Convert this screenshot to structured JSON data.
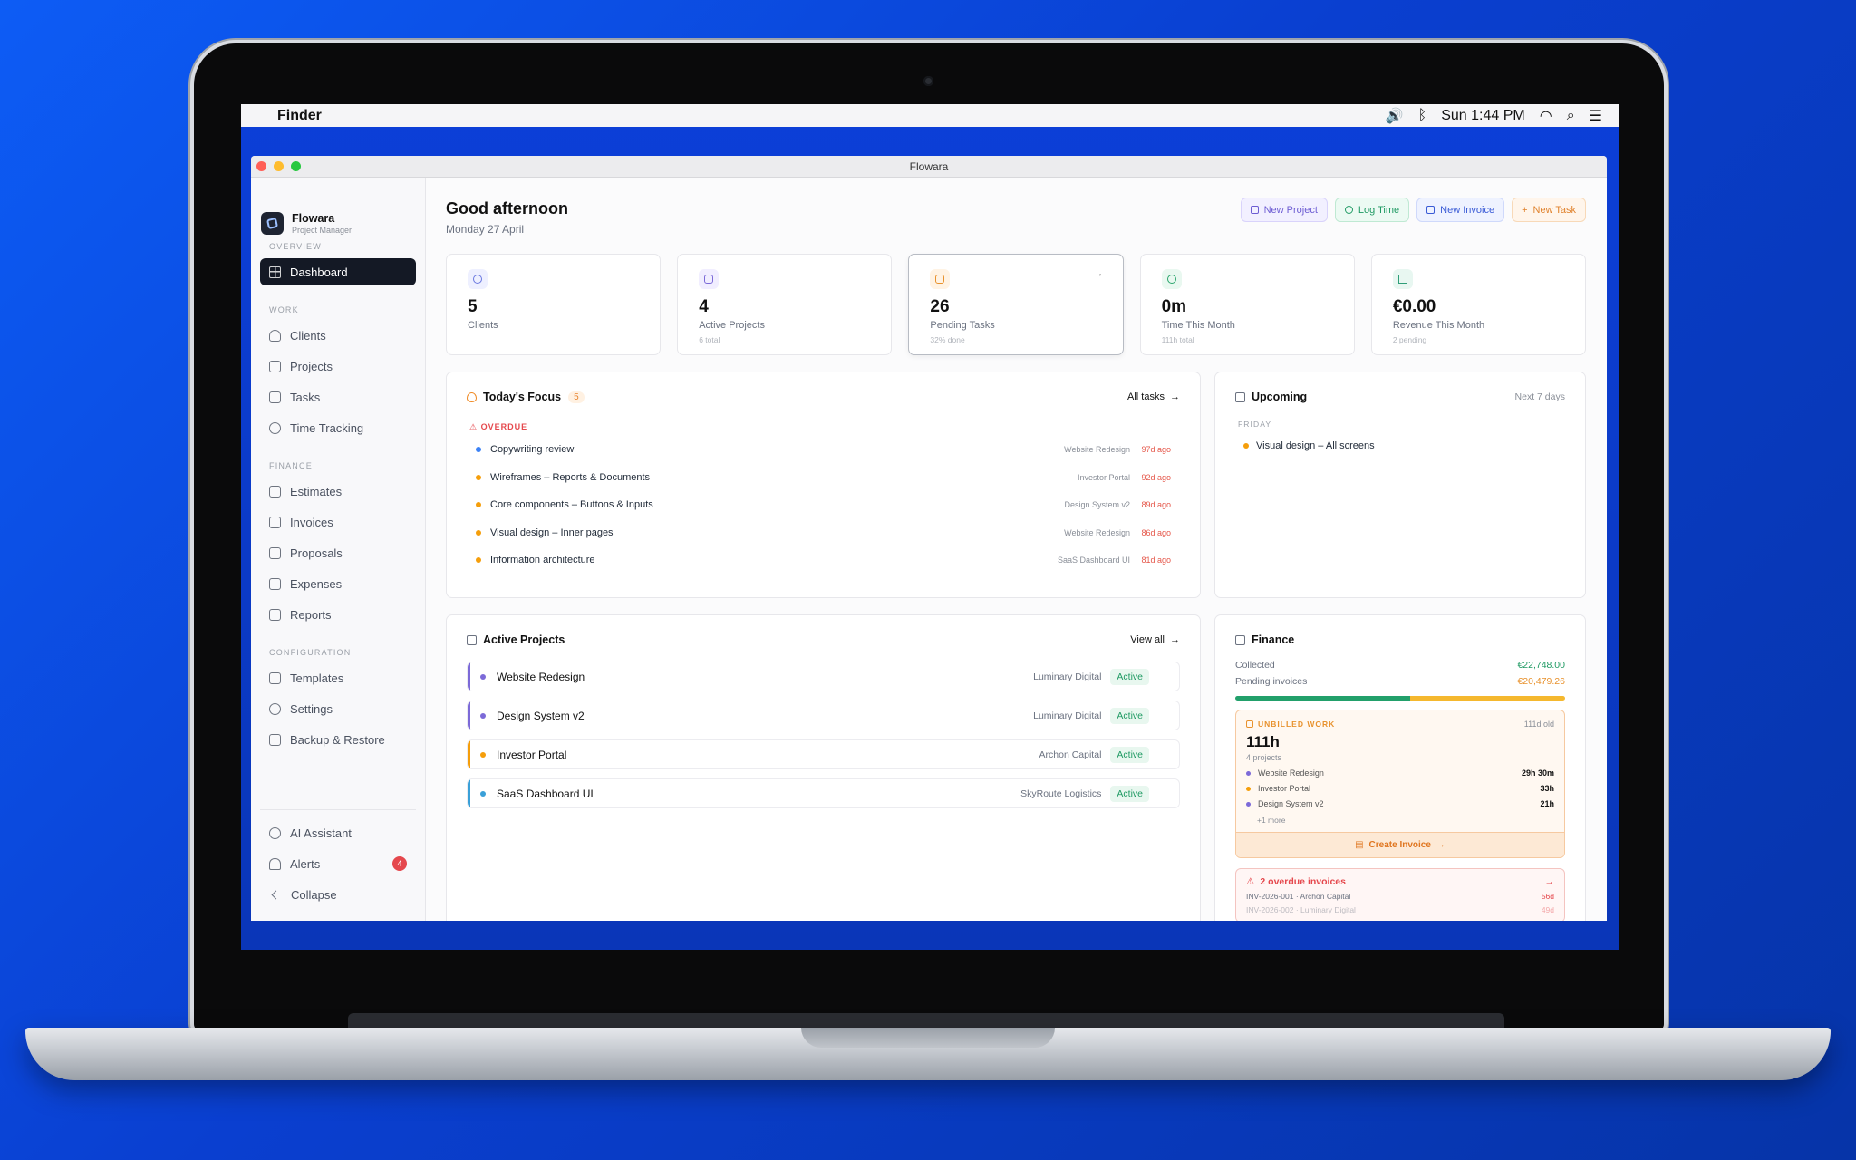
{
  "menubar": {
    "app_name": "Finder",
    "clock": "Sun 1:44 PM"
  },
  "window": {
    "title": "Flowara"
  },
  "brand": {
    "name": "Flowara",
    "subtitle": "Project Manager"
  },
  "sidebar": {
    "sections": {
      "overview": "OVERVIEW",
      "work": "WORK",
      "finance": "FINANCE",
      "configuration": "CONFIGURATION"
    },
    "items": {
      "dashboard": "Dashboard",
      "clients": "Clients",
      "projects": "Projects",
      "tasks": "Tasks",
      "time_tracking": "Time Tracking",
      "estimates": "Estimates",
      "invoices": "Invoices",
      "proposals": "Proposals",
      "expenses": "Expenses",
      "reports": "Reports",
      "templates": "Templates",
      "settings": "Settings",
      "backup": "Backup & Restore",
      "ai_assistant": "AI Assistant",
      "alerts": "Alerts",
      "alerts_count": "4",
      "collapse": "Collapse"
    }
  },
  "header": {
    "greeting": "Good afternoon",
    "date": "Monday 27 April",
    "buttons": {
      "new_project": "New Project",
      "log_time": "Log Time",
      "new_invoice": "New Invoice",
      "new_task": "New Task"
    }
  },
  "stats": [
    {
      "value": "5",
      "label": "Clients",
      "sub": ""
    },
    {
      "value": "4",
      "label": "Active Projects",
      "sub": "6 total"
    },
    {
      "value": "26",
      "label": "Pending Tasks",
      "sub": "32% done"
    },
    {
      "value": "0m",
      "label": "Time This Month",
      "sub": "111h total"
    },
    {
      "value": "€0.00",
      "label": "Revenue This Month",
      "sub": "2 pending"
    }
  ],
  "focus": {
    "title": "Today's Focus",
    "count": "5",
    "link": "All tasks",
    "overdue_label": "OVERDUE",
    "tasks": [
      {
        "title": "Copywriting review",
        "project": "Website Redesign",
        "ago": "97d ago",
        "color": "#3b82f6"
      },
      {
        "title": "Wireframes – Reports & Documents",
        "project": "Investor Portal",
        "ago": "92d ago",
        "color": "#f59e0b"
      },
      {
        "title": "Core components – Buttons & Inputs",
        "project": "Design System v2",
        "ago": "89d ago",
        "color": "#f59e0b"
      },
      {
        "title": "Visual design – Inner pages",
        "project": "Website Redesign",
        "ago": "86d ago",
        "color": "#f59e0b"
      },
      {
        "title": "Information architecture",
        "project": "SaaS Dashboard UI",
        "ago": "81d ago",
        "color": "#f59e0b"
      }
    ]
  },
  "upcoming": {
    "title": "Upcoming",
    "range": "Next 7 days",
    "day": "FRIDAY",
    "item": "Visual design – All screens"
  },
  "active_projects": {
    "title": "Active Projects",
    "link": "View all",
    "rows": [
      {
        "name": "Website Redesign",
        "client": "Luminary Digital",
        "status": "Active",
        "color": "#7c6ad8"
      },
      {
        "name": "Design System v2",
        "client": "Luminary Digital",
        "status": "Active",
        "color": "#7c6ad8"
      },
      {
        "name": "Investor Portal",
        "client": "Archon Capital",
        "status": "Active",
        "color": "#f59e0b"
      },
      {
        "name": "SaaS Dashboard UI",
        "client": "SkyRoute Logistics",
        "status": "Active",
        "color": "#3aa0d8"
      }
    ]
  },
  "finance": {
    "title": "Finance",
    "collected_label": "Collected",
    "collected_value": "€22,748.00",
    "pending_label": "Pending invoices",
    "pending_value": "€20,479.26",
    "collected_share": 0.53,
    "unbilled": {
      "label": "UNBILLED WORK",
      "age": "111d old",
      "hours": "111h",
      "projects": "4 projects",
      "items": [
        {
          "name": "Website Redesign",
          "hours": "29h 30m",
          "color": "#7c6ad8"
        },
        {
          "name": "Investor Portal",
          "hours": "33h",
          "color": "#f59e0b"
        },
        {
          "name": "Design System v2",
          "hours": "21h",
          "color": "#7c6ad8"
        }
      ],
      "more": "+1 more",
      "cta": "Create Invoice"
    },
    "overdue": {
      "title": "2 overdue invoices",
      "lines": [
        {
          "ref": "INV-2026-001 · Archon Capital",
          "days": "56d"
        },
        {
          "ref": "INV-2026-002 · Luminary Digital",
          "days": "49d"
        }
      ]
    }
  }
}
